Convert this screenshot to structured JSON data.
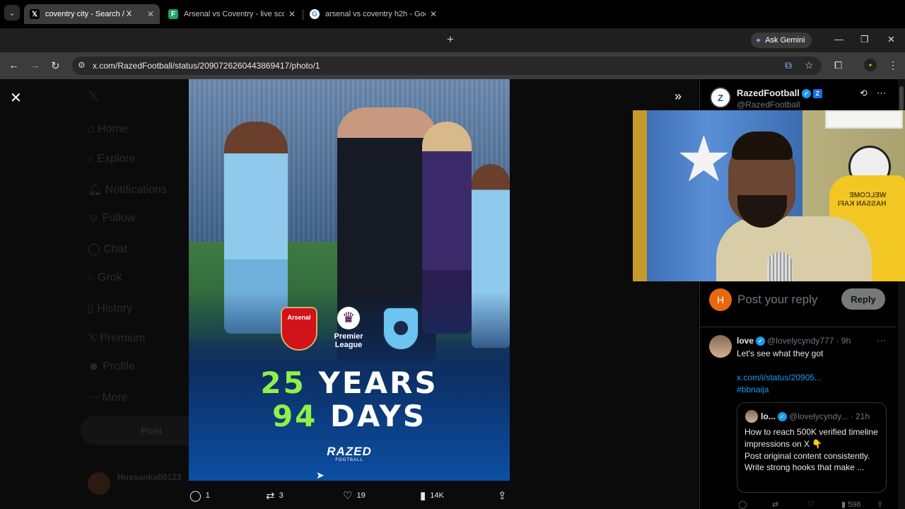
{
  "browser": {
    "tabs": [
      {
        "title": "coventry city - Search / X",
        "icon": "x-logo-icon",
        "active": true
      },
      {
        "title": "Arsenal vs Coventry - live score",
        "icon": "sheets-icon",
        "active": false
      },
      {
        "title": "arsenal vs coventry h2h - Goog",
        "icon": "google-icon",
        "active": false
      }
    ],
    "gemini_label": "Ask Gemini",
    "url": "x.com/RazedFootball/status/2090726260443869417/photo/1"
  },
  "background_nav": {
    "items": [
      "Home",
      "Explore",
      "Notifications",
      "Follow",
      "Chat",
      "Grok",
      "History",
      "Premium",
      "Profile",
      "More"
    ],
    "post_label": "Post",
    "user_name": "Hussankafi0123"
  },
  "photo": {
    "crests": {
      "left": "Arsenal",
      "middle_line1": "Premier",
      "middle_line2": "League"
    },
    "line1_num": "25",
    "line1_word": "YEARS",
    "line2_num": "94",
    "line2_word": "DAYS",
    "brand": "RAZED",
    "brand_sub": "FOOTBALL"
  },
  "actions": {
    "replies": "1",
    "reposts": "3",
    "likes": "19",
    "views": "14K"
  },
  "author": {
    "name": "RazedFootball",
    "handle": "@RazedFootball"
  },
  "reply_box": {
    "avatar_letter": "H",
    "placeholder": "Post your reply",
    "button": "Reply"
  },
  "comment": {
    "name": "love",
    "handle": "@lovelycyndy777 · 9h",
    "text": "Let's see what they got",
    "link": "x.com/i/status/20905...",
    "hashtag": "#bbnaija",
    "quote": {
      "name": "lo...",
      "handle": "@lovelycyndy... · 21h",
      "line1": "How to reach 500K verified timeline impressions on X 👇",
      "line2": "Post original content consistently.",
      "line3": "Write strong hooks that make ..."
    },
    "views": "598"
  },
  "webcam": {
    "shirt_text_line1": "WELCOME",
    "shirt_text_line2": "HASSAN KAFI"
  },
  "colors": {
    "accent_green": "#8ff04a",
    "x_blue": "#1d9bf0",
    "reply_avatar": "#e8680c"
  }
}
